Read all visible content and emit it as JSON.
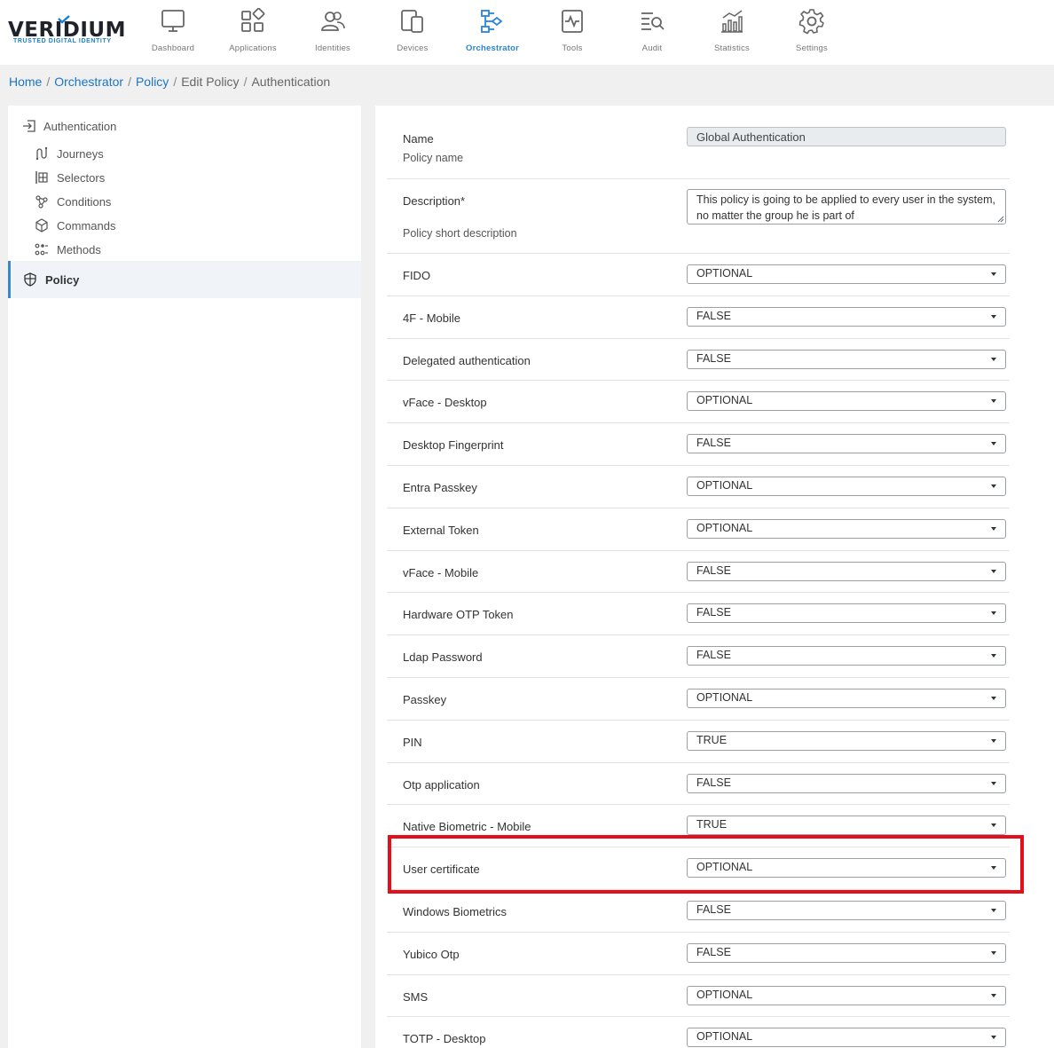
{
  "brand": {
    "name": "VERIDIUM",
    "tagline": "TRUSTED DIGITAL IDENTITY"
  },
  "nav": [
    {
      "key": "dashboard",
      "label": "Dashboard",
      "icon": "monitor-icon"
    },
    {
      "key": "applications",
      "label": "Applications",
      "icon": "applications-grid-icon"
    },
    {
      "key": "identities",
      "label": "Identities",
      "icon": "identities-icon"
    },
    {
      "key": "devices",
      "label": "Devices",
      "icon": "devices-icon"
    },
    {
      "key": "orchestrator",
      "label": "Orchestrator",
      "icon": "orchestrator-flow-icon",
      "active": true
    },
    {
      "key": "tools",
      "label": "Tools",
      "icon": "tools-icon"
    },
    {
      "key": "audit",
      "label": "Audit",
      "icon": "audit-search-icon"
    },
    {
      "key": "statistics",
      "label": "Statistics",
      "icon": "statistics-icon"
    },
    {
      "key": "settings",
      "label": "Settings",
      "icon": "gear-icon"
    }
  ],
  "breadcrumb": {
    "home": "Home",
    "orchestrator": "Orchestrator",
    "policy": "Policy",
    "edit_policy": "Edit Policy",
    "current": "Authentication",
    "separator": "/"
  },
  "sidebar": {
    "heading": "Authentication",
    "items": [
      "Journeys",
      "Selectors",
      "Conditions",
      "Commands",
      "Methods"
    ],
    "active_item": "Policy"
  },
  "form": {
    "name_label": "Name",
    "name_sub": "Policy name",
    "name_value": "Global Authentication",
    "description_label": "Description*",
    "description_sub": "Policy short description",
    "description_value": "This policy is going to be applied to every user in the system, no matter the group he is part of",
    "methods": [
      {
        "label": "FIDO",
        "value": "OPTIONAL"
      },
      {
        "label": "4F - Mobile",
        "value": "FALSE"
      },
      {
        "label": "Delegated authentication",
        "value": "FALSE"
      },
      {
        "label": "vFace - Desktop",
        "value": "OPTIONAL"
      },
      {
        "label": "Desktop Fingerprint",
        "value": "FALSE"
      },
      {
        "label": "Entra Passkey",
        "value": "OPTIONAL"
      },
      {
        "label": "External Token",
        "value": "OPTIONAL"
      },
      {
        "label": "vFace - Mobile",
        "value": "FALSE"
      },
      {
        "label": "Hardware OTP Token",
        "value": "FALSE"
      },
      {
        "label": "Ldap Password",
        "value": "FALSE"
      },
      {
        "label": "Passkey",
        "value": "OPTIONAL"
      },
      {
        "label": "PIN",
        "value": "TRUE"
      },
      {
        "label": "Otp application",
        "value": "FALSE"
      },
      {
        "label": "Native Biometric - Mobile",
        "value": "TRUE"
      },
      {
        "label": "User certificate",
        "value": "OPTIONAL"
      },
      {
        "label": "Windows Biometrics",
        "value": "FALSE"
      },
      {
        "label": "Yubico Otp",
        "value": "FALSE"
      },
      {
        "label": "SMS",
        "value": "OPTIONAL"
      },
      {
        "label": "TOTP - Desktop",
        "value": "OPTIONAL"
      }
    ]
  },
  "colors": {
    "accent": "#2a86d6",
    "highlight": "#e3101c",
    "brand_blue": "#1a7fd0"
  }
}
